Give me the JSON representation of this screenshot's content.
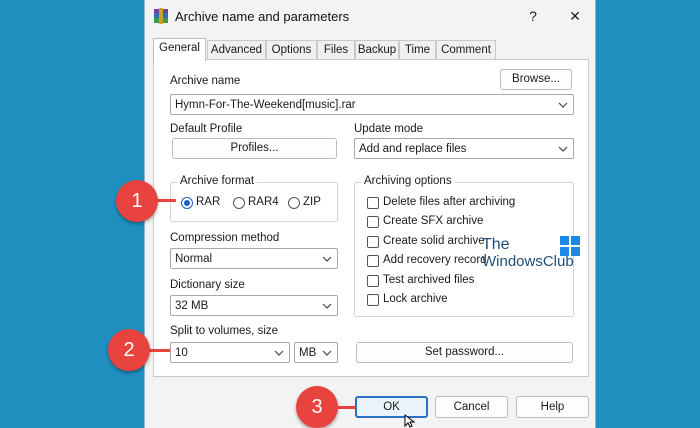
{
  "window": {
    "title": "Archive name and parameters",
    "help_button": "?",
    "close_button": "✕"
  },
  "tabs": [
    "General",
    "Advanced",
    "Options",
    "Files",
    "Backup",
    "Time",
    "Comment"
  ],
  "general": {
    "archive_name_label": "Archive name",
    "browse_button": "Browse...",
    "archive_name_value": "Hymn-For-The-Weekend[music].rar",
    "default_profile_label": "Default Profile",
    "profiles_button": "Profiles...",
    "update_mode_label": "Update mode",
    "update_mode_value": "Add and replace files",
    "archive_format": {
      "title": "Archive format",
      "options": [
        "RAR",
        "RAR4",
        "ZIP"
      ],
      "selected": "RAR"
    },
    "archiving_options": {
      "title": "Archiving options",
      "items": [
        "Delete files after archiving",
        "Create SFX archive",
        "Create solid archive",
        "Add recovery record",
        "Test archived files",
        "Lock archive"
      ]
    },
    "compression_method_label": "Compression method",
    "compression_method_value": "Normal",
    "dictionary_size_label": "Dictionary size",
    "dictionary_size_value": "32 MB",
    "split_label": "Split to volumes, size",
    "split_value": "10",
    "split_unit": "MB",
    "set_password_button": "Set password..."
  },
  "footer": {
    "ok": "OK",
    "cancel": "Cancel",
    "help": "Help"
  },
  "callouts": [
    "1",
    "2",
    "3"
  ],
  "watermark": {
    "line1": "The",
    "line2": "WindowsClub"
  },
  "colors": {
    "background": "#1f8fbf",
    "callout": "#e8433e",
    "accent": "#2b6fc2"
  }
}
